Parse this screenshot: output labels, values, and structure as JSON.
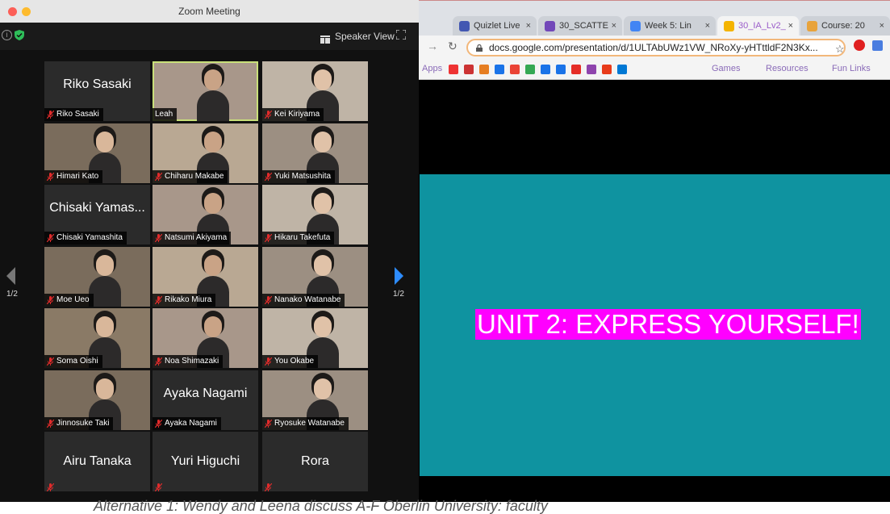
{
  "zoom": {
    "window_title": "Zoom Meeting",
    "speaker_view_label": "Speaker View",
    "traffic_colors": [
      "#fc5f57",
      "#fdbb2e"
    ],
    "active_speaker_color": "#c9e07a",
    "page_left": "1/2",
    "page_right": "1/2",
    "participants": [
      {
        "name": "Riko Sasaki",
        "display": "Riko Sasaki",
        "video": false,
        "muted": true
      },
      {
        "name": "Leah",
        "video": true,
        "muted": false,
        "active": true
      },
      {
        "name": "Kei Kiriyama",
        "video": true,
        "muted": true
      },
      {
        "name": "Himari Kato",
        "video": true,
        "muted": true
      },
      {
        "name": "Chiharu Makabe",
        "video": true,
        "muted": true
      },
      {
        "name": "Yuki Matsushita",
        "video": true,
        "muted": true
      },
      {
        "name": "Chisaki Yamashita",
        "display": "Chisaki Yamas...",
        "video": false,
        "muted": true
      },
      {
        "name": "Natsumi Akiyama",
        "video": true,
        "muted": true
      },
      {
        "name": "Hikaru  Takefuta",
        "video": true,
        "muted": true
      },
      {
        "name": "Moe Ueo",
        "video": true,
        "muted": true
      },
      {
        "name": "Rikako Miura",
        "video": true,
        "muted": true
      },
      {
        "name": "Nanako Watanabe",
        "video": true,
        "muted": true
      },
      {
        "name": "Soma Oishi",
        "video": true,
        "muted": true
      },
      {
        "name": "Noa Shimazaki",
        "video": true,
        "muted": true
      },
      {
        "name": "You Okabe",
        "video": true,
        "muted": true
      },
      {
        "name": "Jinnosuke Taki",
        "video": true,
        "muted": true
      },
      {
        "name": "Ayaka Nagami",
        "display": "Ayaka Nagami",
        "video": false,
        "muted": true
      },
      {
        "name": "Ryosuke Watanabe",
        "video": true,
        "muted": true
      },
      {
        "display": "Airu Tanaka",
        "video": false,
        "muted": true,
        "label_hidden": true
      },
      {
        "display": "Yuri Higuchi",
        "video": false,
        "muted": true,
        "label_hidden": true
      },
      {
        "display": "Rora",
        "video": false,
        "muted": true,
        "label_hidden": true
      }
    ]
  },
  "browser": {
    "tabs": [
      {
        "title": "Quizlet Live",
        "favicon_color": "#4257b2"
      },
      {
        "title": "30_SCATTE",
        "favicon_color": "#7248b9"
      },
      {
        "title": "Week 5: Lin",
        "favicon_color": "#4285f4"
      },
      {
        "title": "30_IA_Lv2_",
        "favicon_color": "#f4b400",
        "active": true
      },
      {
        "title": "Course: 20",
        "favicon_color": "#e8a33b"
      }
    ],
    "url": "docs.google.com/presentation/d/1ULTAbUWz1VW_NRoXy-yHTttldF2N3Kx...",
    "bookmarks": {
      "apps": "Apps",
      "folders": [
        "Games",
        "Resources",
        "Fun Links"
      ],
      "icon_colors": [
        "#e33",
        "#c33",
        "#e67e22",
        "#1a73e8",
        "#ea4335",
        "#34a853",
        "#1a73e8",
        "#1a73e8",
        "#e52d27",
        "#8e44ad",
        "#e83b1a",
        "#0078d4"
      ]
    },
    "slide": {
      "title": "UNIT 2: EXPRESS YOURSELF!",
      "background": "#0f93a0",
      "title_highlight": "#ff00ff"
    }
  },
  "caption": "Alternative 1: Wendy and Leena discuss A-F Oberlin University: faculty"
}
